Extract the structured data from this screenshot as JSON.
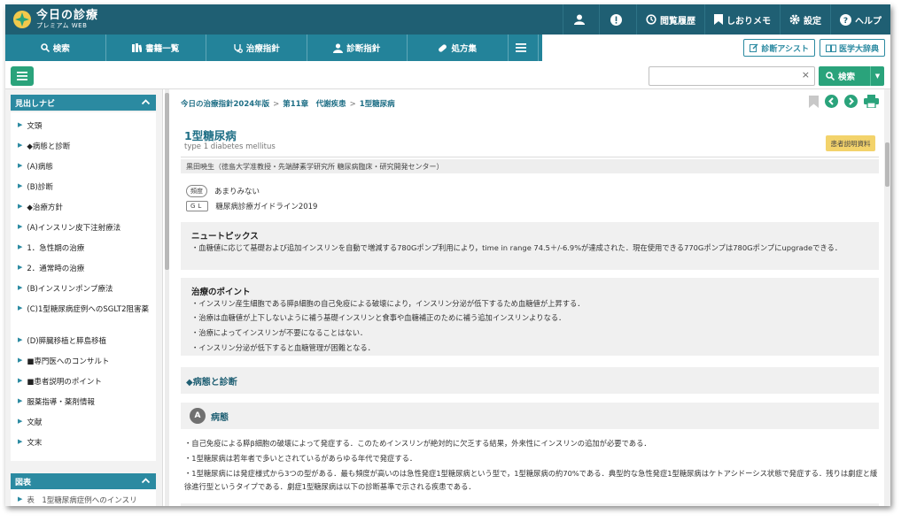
{
  "header": {
    "logo_main": "今日の診療",
    "logo_sub": "プレミアム WEB",
    "nav": [
      {
        "label": "閲覧履歴"
      },
      {
        "label": "しおりメモ"
      },
      {
        "label": "設定"
      },
      {
        "label": "ヘルプ"
      }
    ]
  },
  "mainnav": {
    "items": [
      {
        "label": "検索"
      },
      {
        "label": "書籍一覧"
      },
      {
        "label": "治療指針"
      },
      {
        "label": "診断指針"
      },
      {
        "label": "処方集"
      }
    ],
    "assist_label": "診断アシスト",
    "dictionary_label": "医学大辞典"
  },
  "search": {
    "placeholder": "",
    "clear": "×",
    "button_label": "検索"
  },
  "sidebar": {
    "nav_title": "見出しナビ",
    "items": [
      "文頭",
      "◆病態と診断",
      "(A)病態",
      "(B)診断",
      "◆治療方針",
      "(A)インスリン皮下注射療法",
      "1．急性期の治療",
      "2．通常時の治療",
      "(B)インスリンポンプ療法",
      "(C)1型糖尿病症例へのSGLT2阻害薬",
      "(D)膵臓移植と膵島移植",
      "■専門医へのコンサルト",
      "■患者説明のポイント",
      "服薬指導・薬剤情報",
      "文献",
      "文末"
    ],
    "figures_title": "図表",
    "figures_first": "表　1型糖尿病症例へのインスリ"
  },
  "breadcrumb": [
    "今日の治療指針2024年版",
    "第11章　代謝疾患",
    "1型糖尿病"
  ],
  "article": {
    "title": "1型糖尿病",
    "subtitle": "type 1 diabetes mellitus",
    "badge": "患者説明資料",
    "author": "黒田暁生（徳島大学准教授・先端酵素学研究所 糖尿病臨床・研究開発センター）",
    "frequency_tag": "頻度",
    "frequency_value": "あまりみない",
    "gl_tag": "GL",
    "gl_value": "糖尿病診療ガイドライン2019",
    "news_title": "ニュートピックス",
    "news_text": "・血糖値に応じて基礎および追加インスリンを自動で増減する780Gポンプ利用により，time in range 74.5＋/-6.9%が達成された．現在使用できる770Gポンプは780Gポンプにupgradeできる．",
    "points_title": "治療のポイント",
    "points": [
      "・インスリン産生細胞である膵β細胞の自己免疫による破壊により，インスリン分泌が低下するため血糖値が上昇する．",
      "・治療は血糖値が上下しないように補う基礎インスリンと食事や血糖補正のために補う追加インスリンよりなる．",
      "・治療によってインスリンが不要になることはない．",
      "・インスリン分泌が低下すると血糖管理が困難となる．"
    ],
    "section1": "◆病態と診断",
    "sectionA_letter": "A",
    "sectionA_title": "病態",
    "body": [
      "・自己免疫による膵β細胞の破壊によって発症する．このためインスリンが絶対的に欠乏する結果，外来性にインスリンの追加が必要である．",
      "・1型糖尿病は若年者で多いとされているがあらゆる年代で発症する．",
      "・1型糖尿病には発症様式から3つの型がある．最も頻度が高いのは急性発症1型糖尿病という型で，1型糖尿病の約70%である．典型的な急性発症1型糖尿病はケトアシドーシス状態で発症する．残りは劇症と緩徐進行型というタイプである．劇症1型糖尿病は以下の診断基準で示される疾患である．"
    ]
  }
}
